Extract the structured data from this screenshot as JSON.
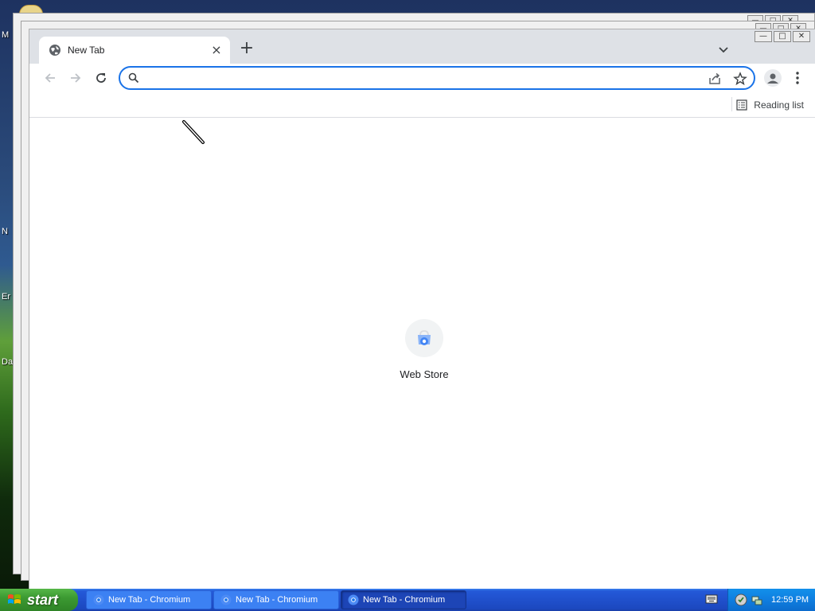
{
  "desktop": {
    "labels": [
      "M",
      "N",
      "Er",
      "Da"
    ]
  },
  "browser": {
    "tab": {
      "title": "New Tab",
      "close_glyph": "×",
      "icon": "globe-icon"
    },
    "new_tab_glyph": "+",
    "window_controls": {
      "minimize": "—",
      "maximize": "□",
      "close": "✕"
    },
    "toolbar": {
      "back_icon": "arrow-back-icon",
      "forward_icon": "arrow-forward-icon",
      "reload_icon": "reload-icon"
    },
    "omnibox": {
      "value": "",
      "placeholder": ""
    },
    "bookmarks": {
      "reading_list_label": "Reading list"
    },
    "shortcuts": [
      {
        "label": "Web Store",
        "icon": "web-store-icon"
      }
    ]
  },
  "taskbar": {
    "start_label": "start",
    "tasks": [
      {
        "label": "New Tab - Chromium",
        "active": false
      },
      {
        "label": "New Tab - Chromium",
        "active": false
      },
      {
        "label": "New Tab - Chromium",
        "active": true
      }
    ],
    "clock": "12:59 PM"
  },
  "colors": {
    "accent": "#1a73e8",
    "tab_strip": "#dee1e6",
    "taskbar": "#2459d8",
    "start": "#3c9a32"
  }
}
